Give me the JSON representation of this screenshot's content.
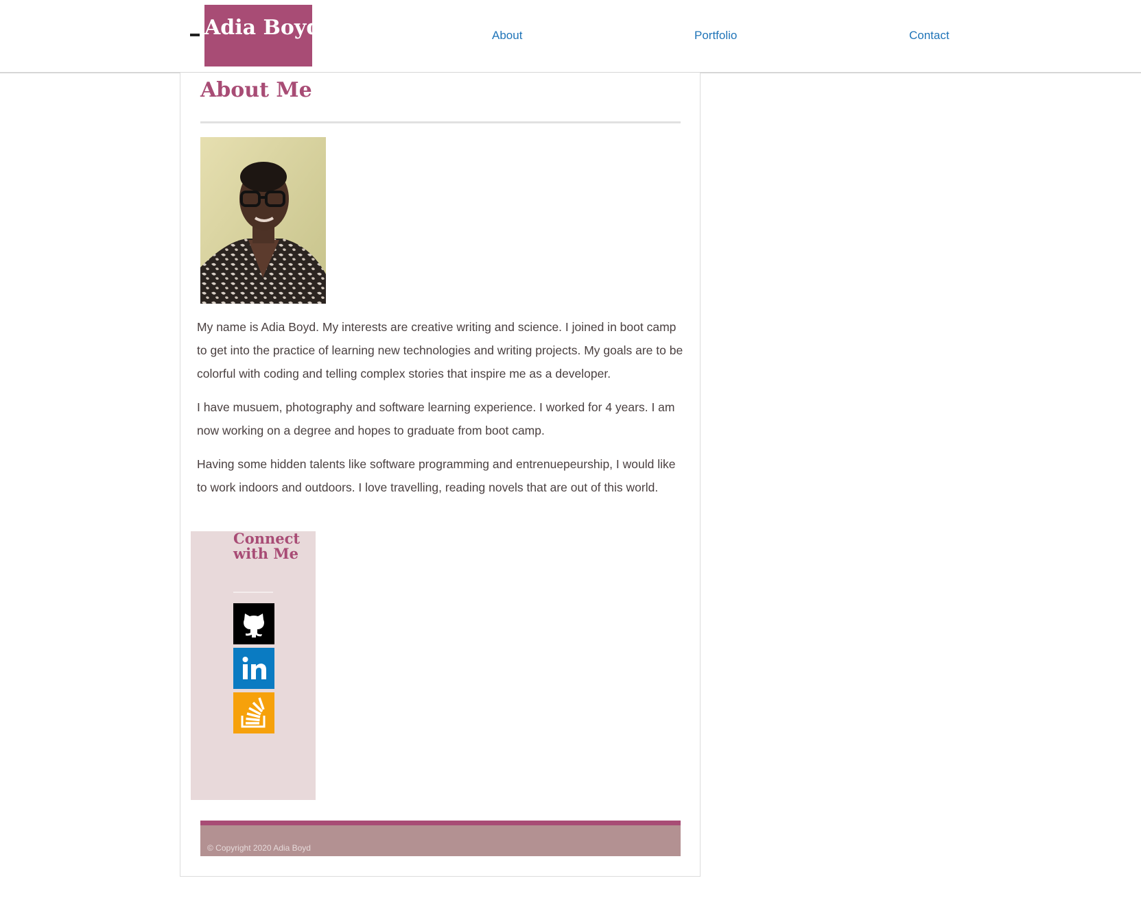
{
  "header": {
    "brand": "Adia Boyd",
    "nav": [
      {
        "label": "About"
      },
      {
        "label": "Portfolio"
      },
      {
        "label": "Contact"
      }
    ]
  },
  "about": {
    "title": "About Me",
    "paragraphs": [
      "My name is Adia Boyd. My interests are creative writing and science. I joined in boot camp to get into the practice of learning new technologies and writing projects. My goals are to be colorful with coding and telling complex stories that inspire me as a developer.",
      "I have musuem, photography and software learning experience. I worked for 4 years. I am now working on a degree and hopes to graduate from boot camp.",
      "Having some hidden talents like software programming and entrenuepeurship, I would like to work indoors and outdoors. I love travelling, reading novels that are out of this world."
    ]
  },
  "connect": {
    "title": "Connect with Me",
    "links": [
      {
        "icon": "github-icon",
        "color": "#000000"
      },
      {
        "icon": "linkedin-icon",
        "color": "#0a7bc2"
      },
      {
        "icon": "stackoverflow-icon",
        "color": "#f6a10b"
      }
    ]
  },
  "footer": {
    "copyright": "© Copyright 2020 Adia Boyd"
  },
  "colors": {
    "brand": "#a84c75",
    "nav_link": "#1f74b8",
    "sidebar_bg": "#e8d9da",
    "footer_bg": "#b39192"
  }
}
